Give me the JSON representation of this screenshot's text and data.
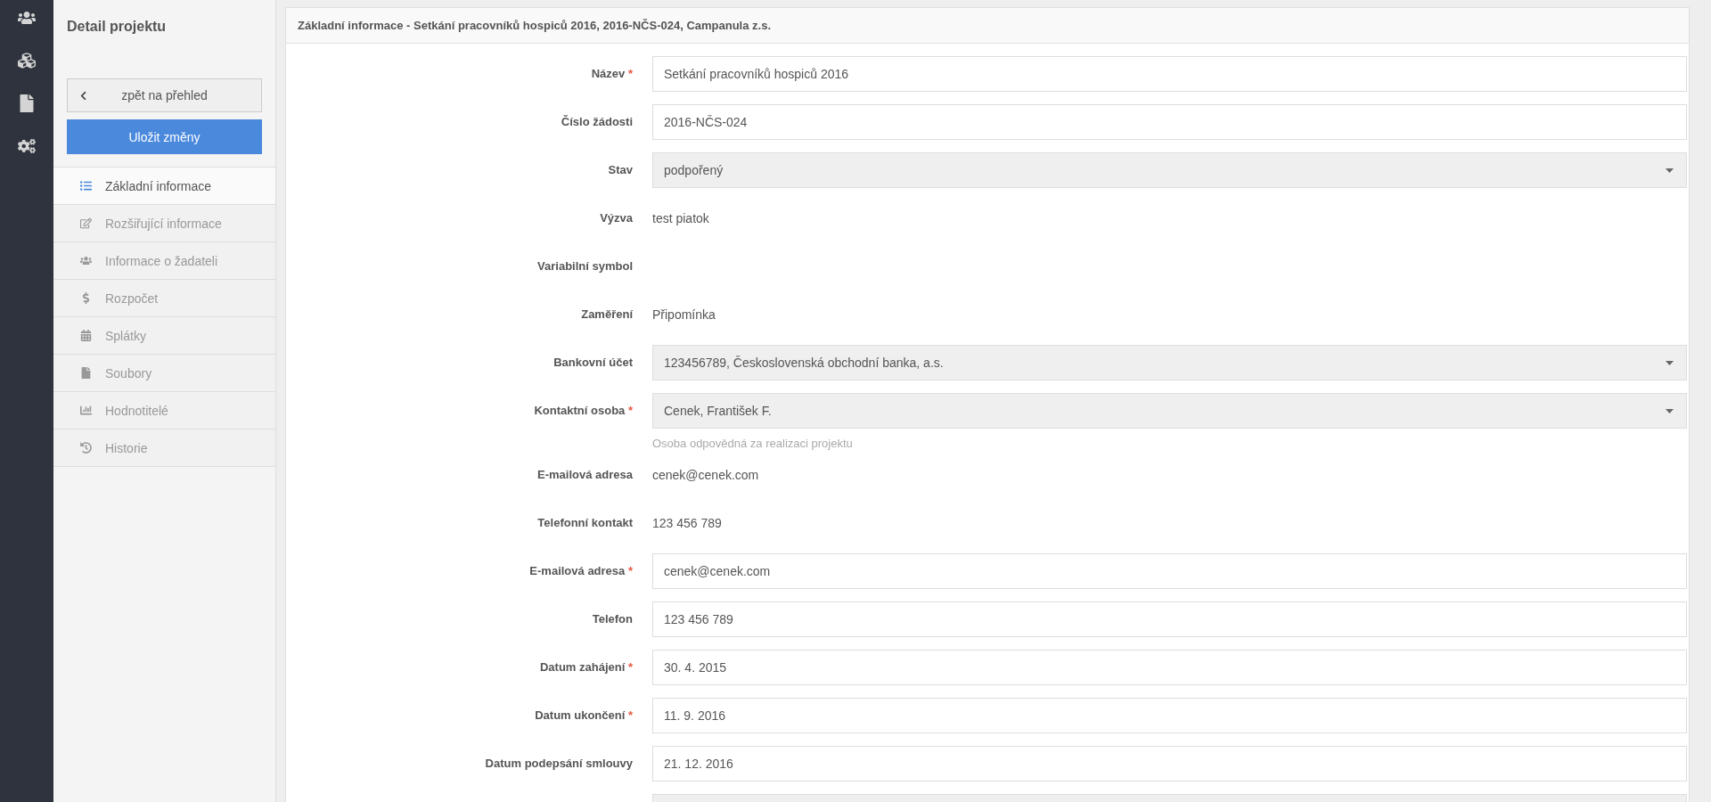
{
  "sidebar": {
    "title": "Detail projektu",
    "back_button": "zpět na přehled",
    "save_button": "Uložit změny",
    "items": [
      {
        "label": "Základní informace",
        "selected": true
      },
      {
        "label": "Rozšiřující informace",
        "selected": false
      },
      {
        "label": "Informace o žadateli",
        "selected": false
      },
      {
        "label": "Rozpočet",
        "selected": false
      },
      {
        "label": "Splátky",
        "selected": false
      },
      {
        "label": "Soubory",
        "selected": false
      },
      {
        "label": "Hodnotitelé",
        "selected": false
      },
      {
        "label": "Historie",
        "selected": false
      }
    ]
  },
  "card": {
    "title": "Základní informace - Setkání pracovníků hospiců 2016, 2016-NČS-024, Campanula z.s.",
    "rows": [
      {
        "kind": "input",
        "label": "Název",
        "required_mark": "*",
        "value": "Setkání pracovníků hospiců 2016"
      },
      {
        "kind": "input",
        "label": "Číslo žádosti",
        "value": "2016-NČS-024"
      },
      {
        "kind": "select",
        "label": "Stav",
        "value": "podpořený"
      },
      {
        "kind": "static",
        "label": "Výzva",
        "value": "test piatok"
      },
      {
        "kind": "static",
        "label": "Variabilní symbol"
      },
      {
        "kind": "static",
        "label": "Zaměření",
        "value": "Připomínka"
      },
      {
        "kind": "select",
        "label": "Bankovní účet",
        "value": "123456789, Československá obchodní banka, a.s."
      },
      {
        "kind": "select",
        "label": "Kontaktní osoba",
        "required_mark": "*",
        "value": "Cenek, František F.",
        "help": "Osoba odpovědná za realizaci projektu"
      },
      {
        "kind": "static",
        "label": "E-mailová adresa",
        "value": "cenek@cenek.com"
      },
      {
        "kind": "static",
        "label": "Telefonní kontakt",
        "value": "123 456 789"
      },
      {
        "kind": "input",
        "label": "E-mailová adresa",
        "required_mark": "*",
        "value": "cenek@cenek.com"
      },
      {
        "kind": "input",
        "label": "Telefon",
        "value": "123 456 789"
      },
      {
        "kind": "input",
        "label": "Datum zahájení",
        "required_mark": "*",
        "value": "30. 4. 2015"
      },
      {
        "kind": "input",
        "label": "Datum ukončení",
        "required_mark": "*",
        "value": "11. 9. 2016"
      },
      {
        "kind": "input",
        "label": "Datum podepsání smlouvy",
        "value": "21. 12. 2016"
      },
      {
        "kind": "select"
      }
    ]
  }
}
